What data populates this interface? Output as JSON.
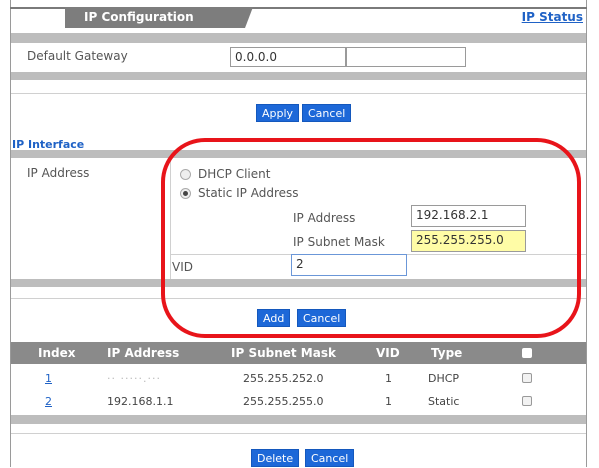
{
  "header": {
    "tab_label": "IP Configuration",
    "ip_status_link": "IP Status"
  },
  "gateway": {
    "label": "Default Gateway",
    "value": "0.0.0.0"
  },
  "top_buttons": {
    "apply": "Apply",
    "cancel": "Cancel"
  },
  "ip_interface": {
    "section_title": "IP Interface",
    "ip_address_label": "IP Address",
    "dhcp_client_label": "DHCP Client",
    "static_ip_label": "Static IP Address",
    "selected_mode": "Static IP Address",
    "static_ip_field_label": "IP Address",
    "static_ip_value": "192.168.2.1",
    "subnet_label": "IP Subnet Mask",
    "subnet_value": "255.255.255.0",
    "vid_label": "VID",
    "vid_value": "2",
    "add": "Add",
    "cancel": "Cancel"
  },
  "table": {
    "columns": [
      "Index",
      "IP Address",
      "IP Subnet Mask",
      "VID",
      "Type"
    ],
    "rows": [
      {
        "index": "1",
        "ip": "·· ·····.···",
        "mask": "255.255.252.0",
        "vid": "1",
        "type": "DHCP"
      },
      {
        "index": "2",
        "ip": "192.168.1.1",
        "mask": "255.255.255.0",
        "vid": "1",
        "type": "Static"
      }
    ]
  },
  "bottom_buttons": {
    "delete": "Delete",
    "cancel": "Cancel"
  },
  "colors": {
    "accent_blue": "#1d68d8",
    "highlight_red": "#e8141a",
    "header_gray": "#8a8a8a",
    "subnet_field_yellow": "#fffca6"
  }
}
